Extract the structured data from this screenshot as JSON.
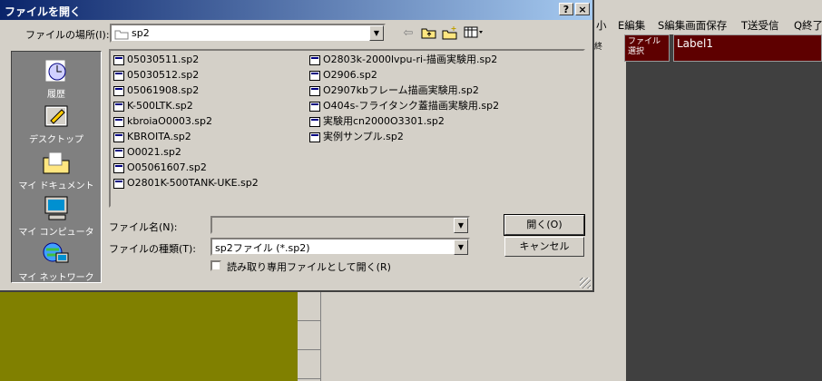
{
  "app": {
    "menu": [
      "小",
      "E編集",
      "S編集画面保存",
      "T送受信",
      "Q終了"
    ],
    "side_caption": "終",
    "file_button": "ファイル\n選択",
    "label1": "Label1",
    "colors": {
      "dark": "#404040",
      "maroon": "#5e0000",
      "olive": "#808000"
    }
  },
  "dialog": {
    "title": "ファイルを開く",
    "help_btn": "?",
    "close_btn": "×",
    "lookin_label": "ファイルの場所(I):",
    "lookin_value": "sp2",
    "toolbar_icons": [
      "back-arrow-icon",
      "up-folder-icon",
      "new-folder-icon",
      "view-menu-icon"
    ],
    "places": [
      {
        "label": "履歴",
        "icon": "history-icon"
      },
      {
        "label": "デスクトップ",
        "icon": "desktop-icon"
      },
      {
        "label": "マイ ドキュメント",
        "icon": "my-documents-icon"
      },
      {
        "label": "マイ コンピュータ",
        "icon": "my-computer-icon"
      },
      {
        "label": "マイ ネットワーク",
        "icon": "my-network-icon"
      }
    ],
    "files_col1": [
      "05030511.sp2",
      "05030512.sp2",
      "05061908.sp2",
      "K-500LTK.sp2",
      "kbroiaO0003.sp2",
      "KBROITA.sp2",
      "O0021.sp2",
      "O05061607.sp2",
      "O2801K-500TANK-UKE.sp2"
    ],
    "files_col2": [
      "O2803k-2000lvpu-ri-描画実験用.sp2",
      "O2906.sp2",
      "O2907kbフレーム描画実験用.sp2",
      "O404s-フライタンク蓋描画実験用.sp2",
      "実験用cn2000O3301.sp2",
      "実例サンプル.sp2"
    ],
    "filename_label": "ファイル名(N):",
    "filename_value": "",
    "filetype_label": "ファイルの種類(T):",
    "filetype_value": "sp2ファイル (*.sp2)",
    "readonly_label": "読み取り専用ファイルとして開く(R)",
    "open_label": "開く(O)",
    "cancel_label": "キャンセル"
  }
}
